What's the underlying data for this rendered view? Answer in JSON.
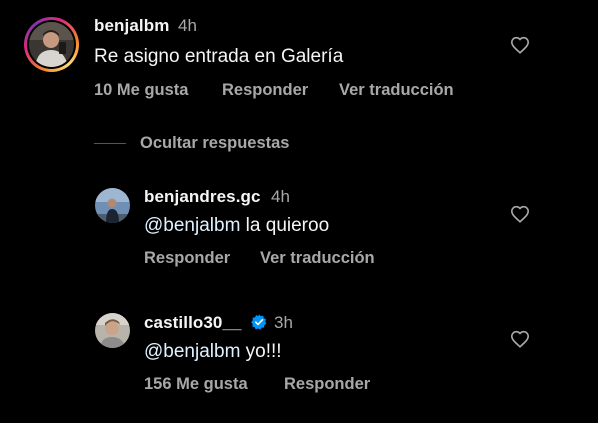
{
  "comments": [
    {
      "username": "benjalbm",
      "time": "4h",
      "text": "Re asigno entrada en Galería",
      "likes": "10 Me gusta",
      "reply": "Responder",
      "translate": "Ver traducción"
    }
  ],
  "hide_replies": "Ocultar respuestas",
  "replies": [
    {
      "username": "benjandres.gc",
      "time": "4h",
      "mention": "@benjalbm",
      "text": " la quieroo",
      "reply": "Responder",
      "translate": "Ver traducción"
    },
    {
      "username": "castillo30__",
      "verified": true,
      "time": "3h",
      "mention": "@benjalbm",
      "text": " yo!!!",
      "likes": "156 Me gusta",
      "reply": "Responder"
    }
  ],
  "colors": {
    "background": "#000000",
    "text": "#f5f5f5",
    "secondary": "#a8a8a8",
    "mention": "#e0f1ff",
    "verified": "#0095f6"
  },
  "icons": {
    "like": "heart-outline-icon",
    "verified": "verified-badge-icon"
  }
}
